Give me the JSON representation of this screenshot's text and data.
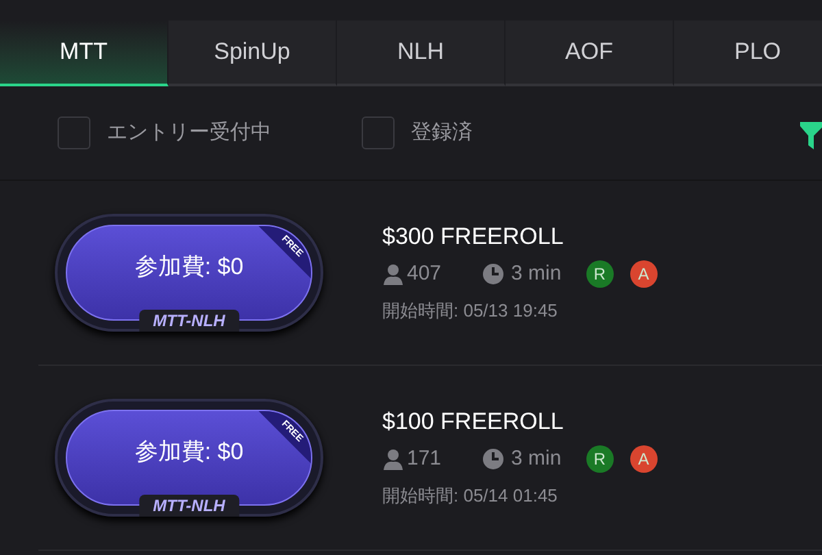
{
  "tabs": [
    {
      "label": "MTT",
      "selected": true
    },
    {
      "label": "SpinUp",
      "selected": false
    },
    {
      "label": "NLH",
      "selected": false
    },
    {
      "label": "AOF",
      "selected": false
    },
    {
      "label": "PLO",
      "selected": false
    }
  ],
  "filters": [
    {
      "label": "エントリー受付中",
      "checked": false
    },
    {
      "label": "登録済",
      "checked": false
    }
  ],
  "tournaments": [
    {
      "buy_in": "参加費: $0",
      "ribbon": "FREE",
      "game": "MTT-NLH",
      "title": "$300 FREEROLL",
      "players": "407",
      "duration": "3 min",
      "badges": [
        {
          "label": "R",
          "color": "#1a7a26"
        },
        {
          "label": "A",
          "color": "#d9452f"
        }
      ],
      "start": "開始時間: 05/13 19:45"
    },
    {
      "buy_in": "参加費: $0",
      "ribbon": "FREE",
      "game": "MTT-NLH",
      "title": "$100 FREEROLL",
      "players": "171",
      "duration": "3 min",
      "badges": [
        {
          "label": "R",
          "color": "#1a7a26"
        },
        {
          "label": "A",
          "color": "#d9452f"
        }
      ],
      "start": "開始時間: 05/14 01:45"
    }
  ]
}
